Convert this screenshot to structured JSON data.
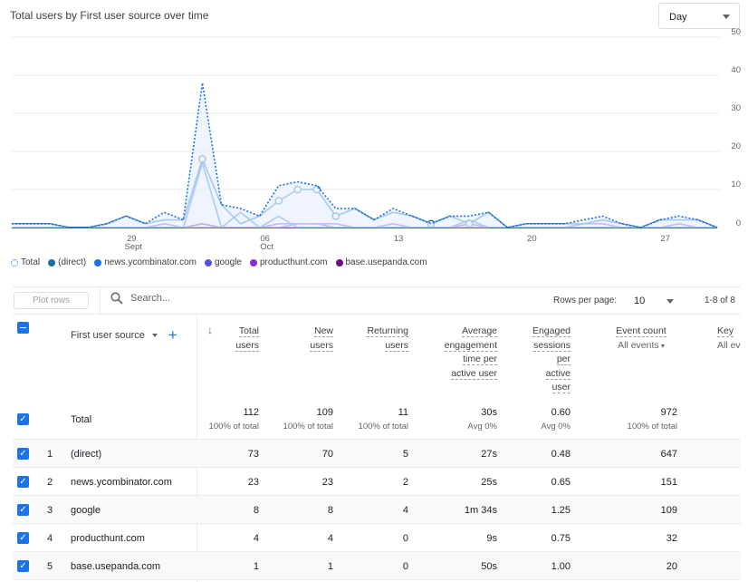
{
  "header": {
    "title": "Total users by First user source over time",
    "granularity": "Day"
  },
  "chart_data": {
    "type": "line",
    "title": "Total users by First user source over time",
    "x": [
      "Sep 23",
      "Sep 24",
      "Sep 25",
      "Sep 26",
      "Sep 27",
      "Sep 28",
      "Sep 29",
      "Sep 30",
      "Oct 01",
      "Oct 02",
      "Oct 03",
      "Oct 04",
      "Oct 05",
      "Oct 06",
      "Oct 07",
      "Oct 08",
      "Oct 09",
      "Oct 10",
      "Oct 11",
      "Oct 12",
      "Oct 13",
      "Oct 14",
      "Oct 15",
      "Oct 16",
      "Oct 17",
      "Oct 18",
      "Oct 19",
      "Oct 20",
      "Oct 21",
      "Oct 22",
      "Oct 23",
      "Oct 24",
      "Oct 25",
      "Oct 26",
      "Oct 27",
      "Oct 28",
      "Oct 29",
      "Oct 30"
    ],
    "x_ticks": [
      {
        "label": "29",
        "sub": "Sept",
        "at": "Sep 29"
      },
      {
        "label": "06",
        "sub": "Oct",
        "at": "Oct 06"
      },
      {
        "label": "13",
        "sub": "",
        "at": "Oct 13"
      },
      {
        "label": "20",
        "sub": "",
        "at": "Oct 20"
      },
      {
        "label": "27",
        "sub": "",
        "at": "Oct 27"
      }
    ],
    "y_ticks": [
      0,
      10,
      20,
      30,
      40,
      50
    ],
    "ylim": [
      0,
      50
    ],
    "grid": true,
    "legend_position": "bottom-left",
    "series": [
      {
        "name": "Total",
        "color": "#1a73e8",
        "style": "dotted-area",
        "values": [
          1,
          1,
          1,
          0,
          0,
          1,
          3,
          1,
          4,
          2,
          38,
          6,
          5,
          3,
          11,
          12,
          11,
          5,
          5,
          2,
          5,
          3,
          1,
          3,
          3,
          4,
          0,
          1,
          1,
          1,
          2,
          3,
          1,
          0,
          2,
          3,
          2,
          0
        ]
      },
      {
        "name": "(direct)",
        "color": "#1a6fa5",
        "style": "solid",
        "markers": [
          10,
          14,
          15,
          16,
          17,
          22,
          24
        ],
        "values": [
          1,
          1,
          1,
          0,
          0,
          1,
          3,
          1,
          2,
          2,
          18,
          6,
          1,
          3,
          7,
          10,
          10,
          3,
          5,
          2,
          4,
          3,
          1,
          3,
          1,
          4,
          0,
          1,
          1,
          1,
          1,
          2,
          1,
          0,
          2,
          2,
          2,
          0
        ]
      },
      {
        "name": "news.ycombinator.com",
        "color": "#1a73e8",
        "style": "solid",
        "values": [
          0,
          0,
          0,
          0,
          0,
          0,
          0,
          0,
          0,
          0,
          17,
          0,
          4,
          0,
          3,
          0,
          0,
          0,
          0,
          0,
          0,
          0,
          0,
          0,
          2,
          0,
          0,
          0,
          0,
          0,
          0,
          0,
          0,
          0,
          0,
          0,
          0,
          0
        ]
      },
      {
        "name": "google",
        "color": "#5553e0",
        "style": "solid",
        "values": [
          0,
          0,
          0,
          0,
          0,
          0,
          0,
          0,
          1,
          0,
          0,
          0,
          0,
          0,
          0,
          1,
          1,
          1,
          0,
          0,
          1,
          0,
          0,
          0,
          0,
          0,
          0,
          0,
          0,
          0,
          1,
          1,
          0,
          0,
          0,
          1,
          0,
          0
        ]
      },
      {
        "name": "producthunt.com",
        "color": "#8430ce",
        "style": "solid",
        "values": [
          0,
          0,
          0,
          0,
          0,
          0,
          0,
          0,
          0,
          0,
          0,
          0,
          0,
          0,
          1,
          1,
          1,
          0,
          0,
          0,
          0,
          0,
          0,
          0,
          1,
          0,
          0,
          0,
          0,
          0,
          0,
          0,
          0,
          0,
          0,
          0,
          0,
          0
        ]
      },
      {
        "name": "base.usepanda.com",
        "color": "#6d0b8a",
        "style": "solid",
        "values": [
          0,
          0,
          0,
          0,
          0,
          0,
          0,
          0,
          0,
          0,
          1,
          0,
          0,
          0,
          0,
          0,
          0,
          0,
          0,
          0,
          0,
          0,
          0,
          0,
          0,
          0,
          0,
          0,
          0,
          0,
          0,
          0,
          0,
          0,
          0,
          0,
          0,
          0
        ]
      }
    ]
  },
  "toolbar": {
    "plot_rows": "Plot rows",
    "search_placeholder": "Search...",
    "rows_per_page_label": "Rows per page:",
    "rows_per_page": "10",
    "pagination": "1-8 of 8"
  },
  "table": {
    "dimension": "First user source",
    "columns": [
      {
        "l1": "Total",
        "l2": "users"
      },
      {
        "l1": "New",
        "l2": "users"
      },
      {
        "l1": "Returning",
        "l2": "users"
      },
      {
        "l1": "Average",
        "l2": "engagement",
        "l3": "time per",
        "l4": "active user"
      },
      {
        "l1": "Engaged",
        "l2": "sessions",
        "l3": "per",
        "l4": "active",
        "l5": "user"
      },
      {
        "l1": "Event count",
        "sub": "All events"
      },
      {
        "l1": "Key",
        "sub": "All ev"
      }
    ],
    "total": {
      "label": "Total",
      "values": [
        "112",
        "109",
        "11",
        "30s",
        "0.60",
        "972"
      ],
      "subs": [
        "100% of total",
        "100% of total",
        "100% of total",
        "Avg 0%",
        "Avg 0%",
        "100% of total"
      ]
    },
    "rows": [
      {
        "n": "1",
        "source": "(direct)",
        "values": [
          "73",
          "70",
          "5",
          "27s",
          "0.48",
          "647"
        ]
      },
      {
        "n": "2",
        "source": "news.ycombinator.com",
        "values": [
          "23",
          "23",
          "2",
          "25s",
          "0.65",
          "151"
        ]
      },
      {
        "n": "3",
        "source": "google",
        "values": [
          "8",
          "8",
          "4",
          "1m 34s",
          "1.25",
          "109"
        ]
      },
      {
        "n": "4",
        "source": "producthunt.com",
        "values": [
          "4",
          "4",
          "0",
          "9s",
          "0.75",
          "32"
        ]
      },
      {
        "n": "5",
        "source": "base.usepanda.com",
        "values": [
          "1",
          "1",
          "0",
          "50s",
          "1.00",
          "20"
        ]
      }
    ]
  }
}
